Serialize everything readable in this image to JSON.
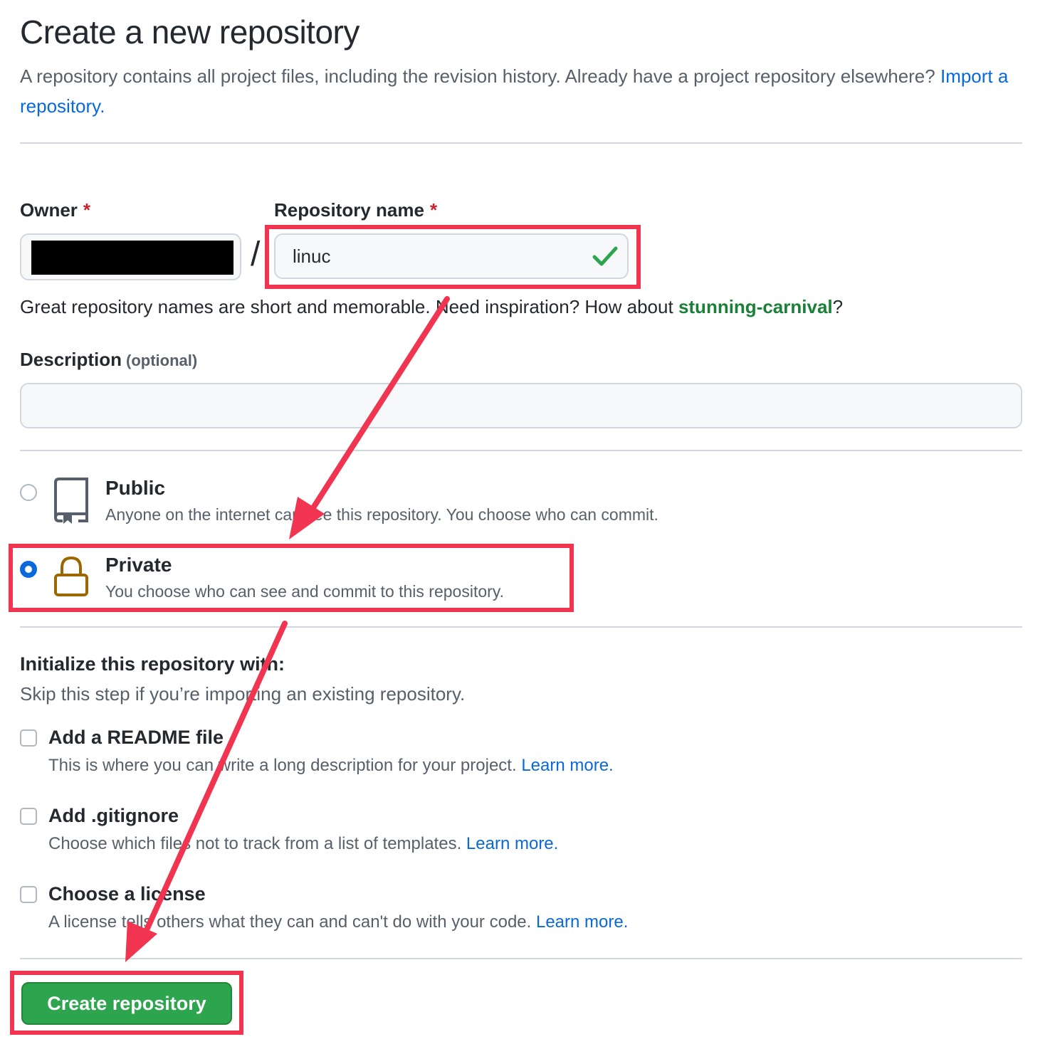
{
  "header": {
    "title": "Create a new repository",
    "subtitle": "A repository contains all project files, including the revision history. Already have a project repository elsewhere?",
    "import_link": "Import a repository."
  },
  "owner": {
    "label": "Owner",
    "required_mark": "*"
  },
  "repo_name": {
    "label": "Repository name",
    "required_mark": "*",
    "value": "linuc",
    "slash": "/"
  },
  "hint": {
    "text": "Great repository names are short and memorable. Need inspiration? How about",
    "suggestion": "stunning-carnival",
    "suffix": "?"
  },
  "description": {
    "label": "Description",
    "optional": "(optional)",
    "value": ""
  },
  "visibility": {
    "selected": "Private",
    "options": [
      {
        "title": "Public",
        "desc": "Anyone on the internet can see this repository. You choose who can commit.",
        "icon": "repo-icon"
      },
      {
        "title": "Private",
        "desc": "You choose who can see and commit to this repository.",
        "icon": "lock-icon"
      }
    ]
  },
  "init": {
    "title": "Initialize this repository with:",
    "desc": "Skip this step if you’re importing an existing repository.",
    "options": [
      {
        "title": "Add a README file",
        "desc": "This is where you can write a long description for your project.",
        "link": "Learn more.",
        "checked": false
      },
      {
        "title": "Add .gitignore",
        "desc": "Choose which files not to track from a list of templates.",
        "link": "Learn more.",
        "checked": false
      },
      {
        "title": "Choose a license",
        "desc": "A license tells others what they can and can't do with your code.",
        "link": "Learn more.",
        "checked": false
      }
    ]
  },
  "create_button": "Create repository",
  "colors": {
    "accent_green": "#2da44e",
    "link_blue": "#0969da",
    "annotation_red": "#f1344f",
    "check_green": "#1a7f37",
    "lock_brown": "#9a6700"
  }
}
